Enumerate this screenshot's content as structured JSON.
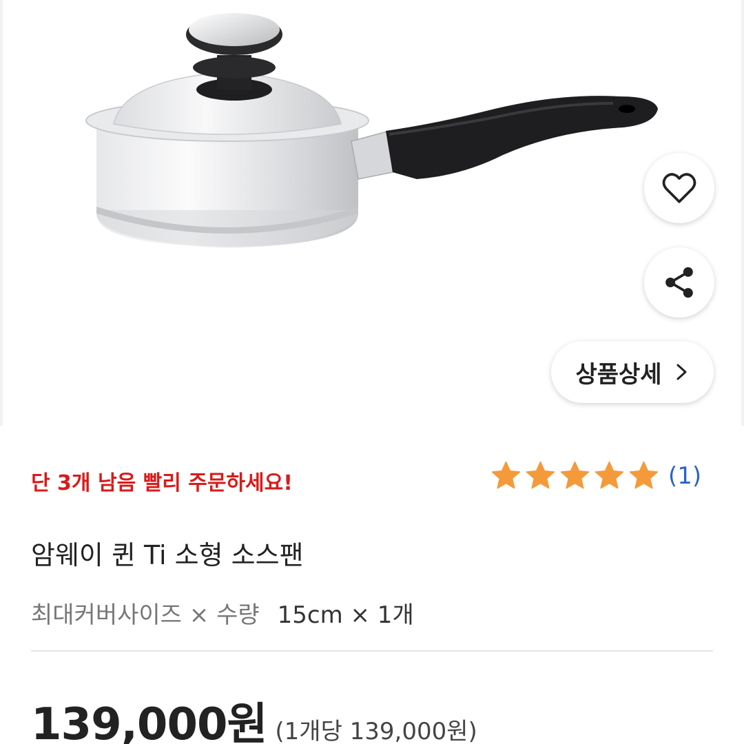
{
  "icons": {
    "wishlist": "heart-icon",
    "share": "share-icon",
    "detail_arrow": "chevron-right-icon",
    "rating_star": "star-icon"
  },
  "product_detail_button": {
    "label": "상품상세"
  },
  "stock_notice": "단 3개 남음 빨리 주문하세요!",
  "rating": {
    "stars": 5,
    "max": 5,
    "review_count": "(1)",
    "star_color": "#f59a3b"
  },
  "product": {
    "name": "암웨이 퀸 Ti 소형 소스팬",
    "option_label": "최대커버사이즈 × 수량",
    "option_value": "15cm × 1개",
    "price": "139,000원",
    "unit_price": "(1개당 139,000원)"
  },
  "colors": {
    "notice_red": "#d81b1b",
    "review_count_blue": "#2a63c7",
    "star_orange": "#f59a3b"
  }
}
